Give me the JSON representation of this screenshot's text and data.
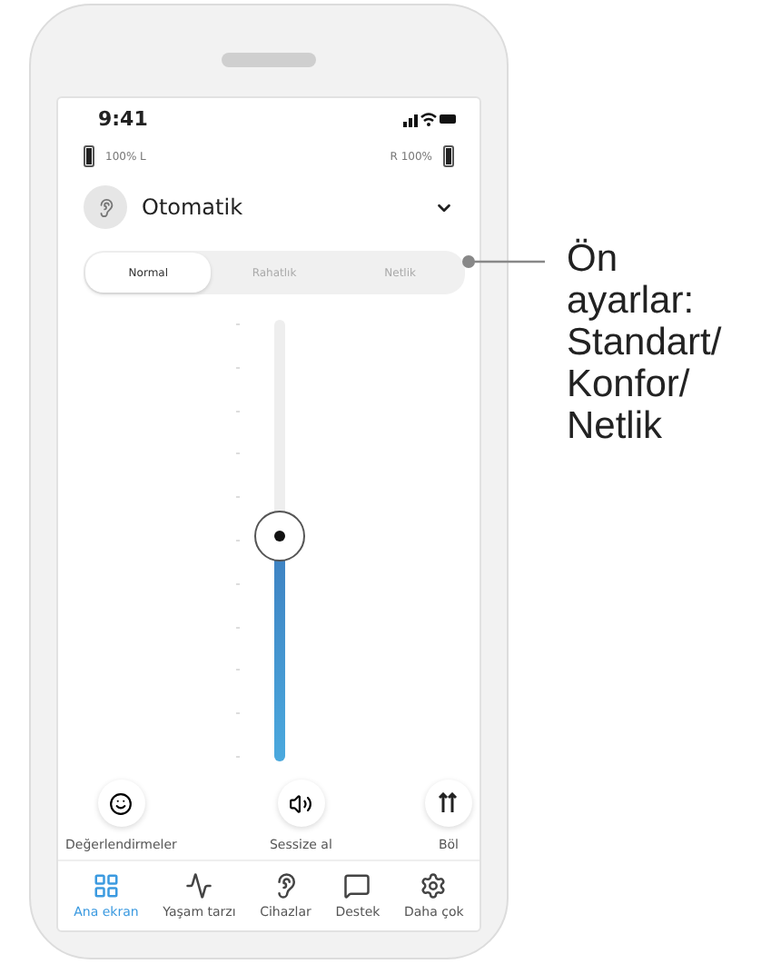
{
  "status_bar": {
    "time": "9:41"
  },
  "batteries": {
    "left": "100% L",
    "right": "R 100%"
  },
  "program": {
    "name": "Otomatik"
  },
  "presets": [
    {
      "label": "Normal",
      "selected": true
    },
    {
      "label": "Rahatlık",
      "selected": false
    },
    {
      "label": "Netlik",
      "selected": false
    }
  ],
  "volume": {
    "level": 0.51
  },
  "actions": [
    {
      "kind": "face",
      "label": "Değerlendirmeler"
    },
    {
      "kind": "speaker",
      "label": "Sessize al"
    },
    {
      "kind": "split",
      "label": "Böl"
    }
  ],
  "tab_bar": [
    {
      "kind": "home",
      "label": "Ana ekran",
      "selected": true
    },
    {
      "kind": "pulse",
      "label": "Yaşam tarzı",
      "selected": false
    },
    {
      "kind": "device",
      "label": "Cihazlar",
      "selected": false
    },
    {
      "kind": "chat",
      "label": "Destek",
      "selected": false
    },
    {
      "kind": "gear",
      "label": "Daha çok",
      "selected": false
    }
  ],
  "annotation": {
    "text": "Ön ayarlar: Standart/ Konfor/ Netlik"
  }
}
